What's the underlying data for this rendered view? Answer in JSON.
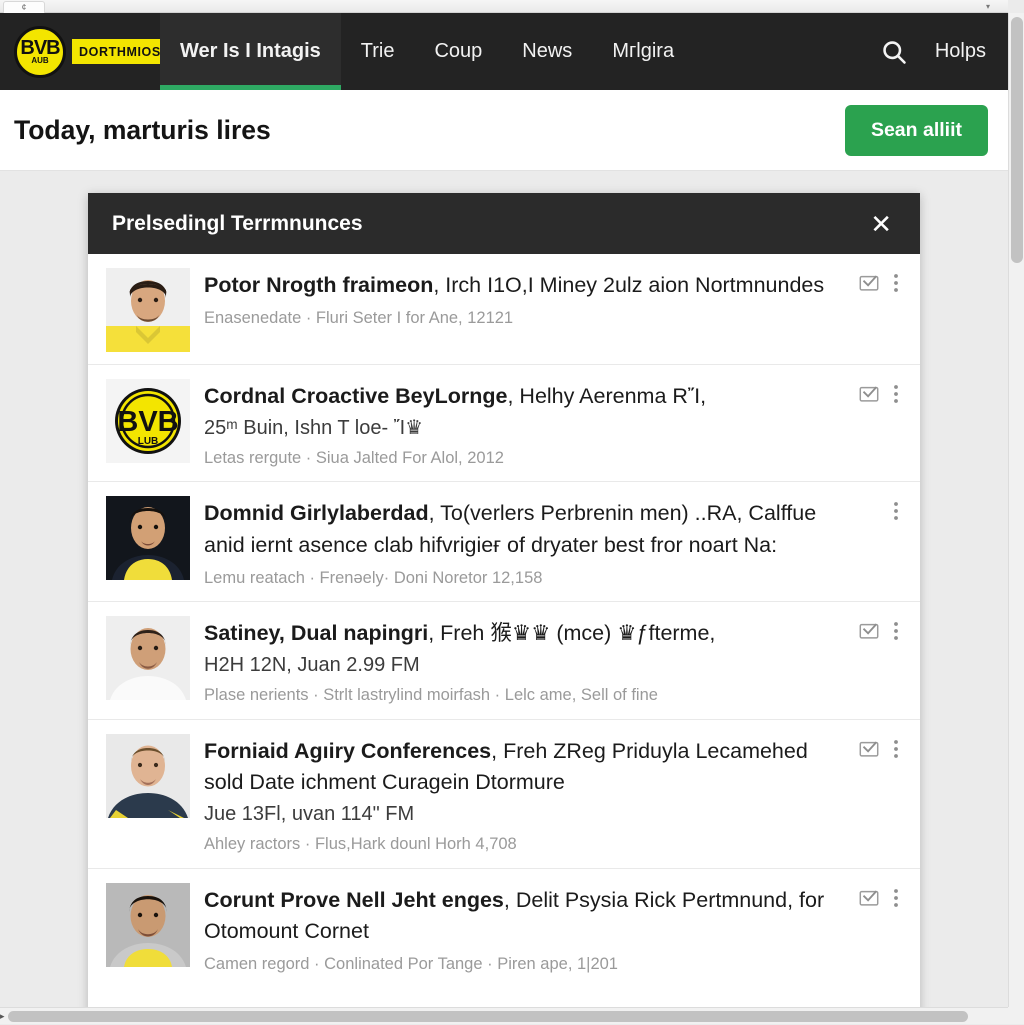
{
  "browser": {
    "tab_label": "¢",
    "right_marker": "▾"
  },
  "header": {
    "brand": {
      "badge_main": "BVB",
      "badge_sub": "AUB",
      "wordmark": "DORTHMIOS"
    },
    "nav": [
      {
        "label": "Wer Is I Intagis",
        "active": true
      },
      {
        "label": "Trie",
        "active": false
      },
      {
        "label": "Coup",
        "active": false
      },
      {
        "label": "News",
        "active": false
      },
      {
        "label": "Mгlgira",
        "active": false
      }
    ],
    "search_icon": "search-icon",
    "help_label": "Holps",
    "colors": {
      "bar_background": "#232323",
      "active_underline": "#2eaa63",
      "brand_yellow": "#f3e500"
    }
  },
  "title_bar": {
    "title": "Today, marturis lires",
    "scan_button": "Sean alliit",
    "button_color": "#2ba24f"
  },
  "modal": {
    "title": "Prelsedingl Terrmnunces",
    "close_icon": "close-icon",
    "header_color": "#2b2b2b",
    "rows": [
      {
        "avatar": "player-portrait",
        "lead": "Potor Nrogth fraimeon",
        "text": ", Irch I1O,I Miney 2ulz aion Nortmnundes",
        "sub": "",
        "meta": "Enasenedate · Fluri Seter I for Ane, 12121",
        "has_mark_read": true
      },
      {
        "avatar": "bvb-logo",
        "lead": "Cordnal Croactive BeyLornge",
        "text": ", Helhy Aerenma RἼ,",
        "sub": "25ᵐ Buin, Ishn T loe- Ἴ♛",
        "meta": "Letas rergute · Siua Jalted For Alol, 2012",
        "has_mark_read": true
      },
      {
        "avatar": "player-portrait",
        "lead": "Domnid Girlylaberdad",
        "text": ", To(verlers Perbrenin men) ..RA, Calffue anid iernt asence clab hifᴠrigieғ of dryater best fror noart Na:",
        "sub": "",
        "meta": "Lemu reatach · Frenǝely· Doni Noretor 12,158",
        "has_mark_read": false
      },
      {
        "avatar": "player-portrait",
        "lead": "Satiney, Dual napingri",
        "text": ", Freh 猴♛♛ (mce) ♛ƒfterme,",
        "sub": "H2H 12N, Juan  2.99 FM",
        "meta": "Plase nerients · Strlt lastrylind moirfash · Lelc ame, Sell of fine",
        "has_mark_read": true
      },
      {
        "avatar": "player-portrait",
        "lead": "Forniaid Agıiry Conferences",
        "text": ", Freh ZReg Priduyla Lecamehed sold Date ichment Curagein Dtormure",
        "sub": "Jue 13Fl,  uvan  114ʺ FM",
        "meta": "Ahley ractors · Flus,Hark dounl Horh  4,708",
        "has_mark_read": true
      },
      {
        "avatar": "player-portrait",
        "lead": "Corunt Prove Nell Jeht enges",
        "text": ", Delit Psysia Rick Pertmnund, for Otomount Cornet",
        "sub": "",
        "meta": "Camen regord · Conlinated Por Tange · Piren ape, 1|201",
        "has_mark_read": true
      }
    ],
    "row_icons": {
      "mark_read": "envelope-check-icon",
      "overflow": "kebab-menu-icon"
    }
  },
  "scrollbars": {
    "vertical_arrow": "▾",
    "horizontal_arrow": "▸"
  }
}
